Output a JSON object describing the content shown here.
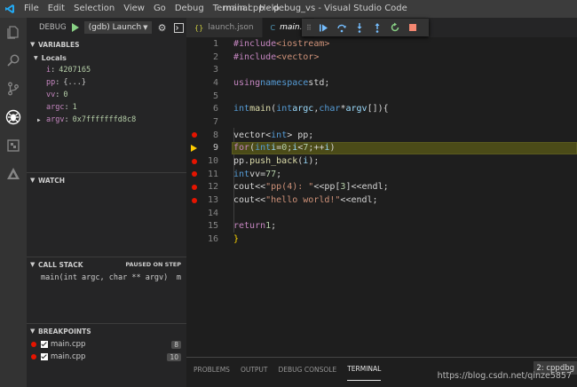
{
  "titlebar": {
    "menu": [
      "File",
      "Edit",
      "Selection",
      "View",
      "Go",
      "Debug",
      "Terminal",
      "Help"
    ],
    "title": "main.cpp - debug_vs - Visual Studio Code"
  },
  "activitybar": {
    "icons": [
      "files-icon",
      "search-icon",
      "source-control-icon",
      "debug-icon",
      "extensions-icon",
      "deploy-icon"
    ]
  },
  "sidebar": {
    "debug_label": "DEBUG",
    "config": "(gdb) Launch",
    "variables_header": "VARIABLES",
    "locals_label": "Locals",
    "variables": [
      {
        "name": "i",
        "value": "4207165"
      },
      {
        "name": "pp",
        "value": "{...}"
      },
      {
        "name": "vv",
        "value": "0"
      },
      {
        "name": "argc",
        "value": "1"
      },
      {
        "name": "argv",
        "value": "0x7fffffffd8c8"
      }
    ],
    "watch_header": "WATCH",
    "callstack_header": "CALL STACK",
    "callstack_status": "PAUSED ON STEP",
    "callstack_frame": "main(int argc, char ** argv)",
    "callstack_file": "m",
    "breakpoints_header": "BREAKPOINTS",
    "breakpoints": [
      {
        "file": "main.cpp",
        "line": "8"
      },
      {
        "file": "main.cpp",
        "line": "10"
      }
    ]
  },
  "editor": {
    "tabs": [
      {
        "label": "launch.json",
        "icon": "{}"
      },
      {
        "label": "main.c",
        "icon": "C"
      }
    ],
    "line_numbers": [
      "1",
      "2",
      "3",
      "4",
      "5",
      "6",
      "7",
      "8",
      "9",
      "10",
      "11",
      "12",
      "13",
      "14",
      "15",
      "16"
    ],
    "current_line": 9,
    "breakpoint_lines": [
      8,
      10,
      11,
      12,
      13
    ]
  },
  "panel": {
    "tabs": [
      "PROBLEMS",
      "OUTPUT",
      "DEBUG CONSOLE",
      "TERMINAL"
    ],
    "active_tab": "TERMINAL",
    "terminal_select": "2: cppdbg",
    "watermark": "https://blog.csdn.net/qinze5857"
  },
  "colors": {
    "activitybar": "#333333",
    "sidebar": "#252526",
    "editor": "#1e1e1e",
    "breakpoint": "#e51400",
    "current_line": "#4b4b18"
  }
}
